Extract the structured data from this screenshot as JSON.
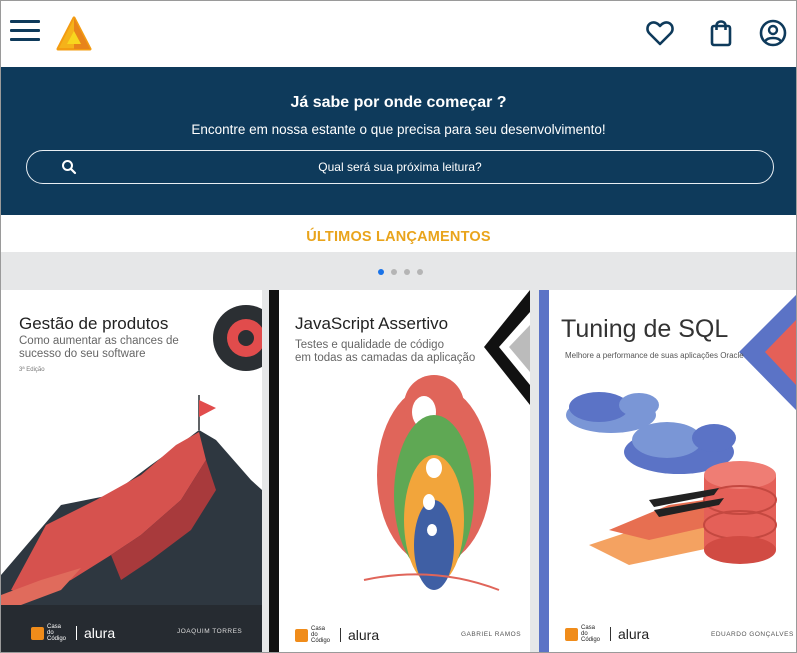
{
  "header": {
    "menu_icon": "hamburger-menu-icon",
    "logo_icon": "triangle-logo-icon",
    "actions": [
      {
        "name": "favorites",
        "icon": "heart-icon"
      },
      {
        "name": "cart",
        "icon": "shopping-bag-icon"
      },
      {
        "name": "account",
        "icon": "user-circle-icon"
      }
    ]
  },
  "hero": {
    "title": "Já sabe por onde começar ?",
    "subtitle": "Encontre em nossa estante o que precisa para seu desenvolvimento!",
    "search_placeholder": "Qual será sua próxima leitura?"
  },
  "releases": {
    "title": "ÚLTIMOS LANÇAMENTOS",
    "active_slide": 1,
    "slide_count": 4,
    "books": [
      {
        "title": "Gestão de produtos",
        "subtitle_line1": "Como aumentar as chances de",
        "subtitle_line2": "sucesso do seu software",
        "edition": "3ª Edição",
        "author": "JOAQUIM TORRES",
        "publisher": "Casa do Código",
        "partner": "alura"
      },
      {
        "title": "JavaScript Assertivo",
        "subtitle_line1": "Testes e qualidade de código",
        "subtitle_line2": "em todas as camadas da aplicação",
        "author": "GABRIEL RAMOS",
        "publisher": "Casa do Código",
        "partner": "alura"
      },
      {
        "title": "Tuning de SQL",
        "subtitle_line1": "Melhore a performance de suas aplicações Oracle",
        "author": "EDUARDO GONÇALVES",
        "publisher": "Casa do Código",
        "partner": "alura"
      }
    ]
  },
  "colors": {
    "navy": "#0e3a5b",
    "accent_orange": "#e9a41c",
    "dot_active": "#1a73e8",
    "band_gray": "#e6e7e8"
  }
}
